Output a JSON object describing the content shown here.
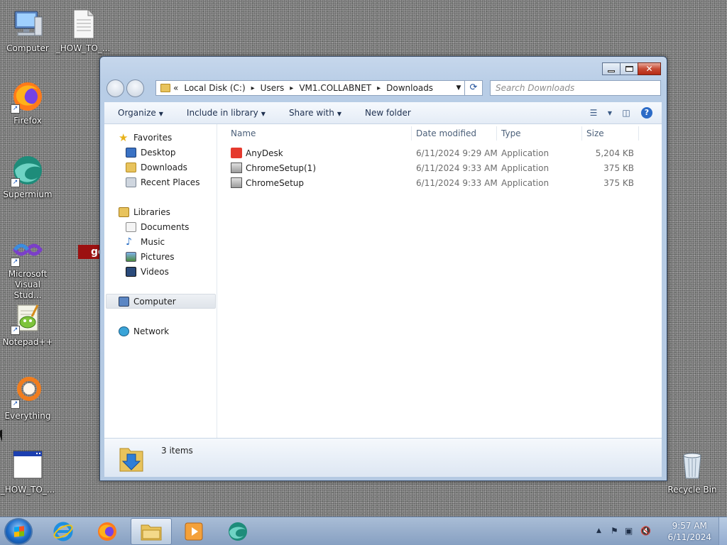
{
  "desktop": {
    "icons": [
      {
        "label": "Computer"
      },
      {
        "label": "_HOW_TO_..."
      },
      {
        "label": "Firefox"
      },
      {
        "label": "Supermium"
      },
      {
        "label": "Microsoft Visual Stud..."
      },
      {
        "label": "Notepad++"
      },
      {
        "label": "Everything"
      },
      {
        "label": "_HOW_TO_..."
      },
      {
        "label": "Recycle Bin"
      }
    ],
    "partial_text": "ge"
  },
  "window": {
    "address": {
      "overflow": "«",
      "crumbs": [
        "Local Disk (C:)",
        "Users",
        "VM1.COLLABNET",
        "Downloads"
      ]
    },
    "search_placeholder": "Search Downloads",
    "toolbar": {
      "organize": "Organize",
      "include_in_library": "Include in library",
      "share_with": "Share with",
      "new_folder": "New folder"
    },
    "nav": {
      "favorites": "Favorites",
      "desktop": "Desktop",
      "downloads": "Downloads",
      "recent_places": "Recent Places",
      "libraries": "Libraries",
      "documents": "Documents",
      "music": "Music",
      "pictures": "Pictures",
      "videos": "Videos",
      "computer": "Computer",
      "network": "Network"
    },
    "columns": {
      "name": "Name",
      "date_modified": "Date modified",
      "type": "Type",
      "size": "Size"
    },
    "files": [
      {
        "name": "AnyDesk",
        "date": "6/11/2024 9:29 AM",
        "type": "Application",
        "size": "5,204 KB"
      },
      {
        "name": "ChromeSetup(1)",
        "date": "6/11/2024 9:33 AM",
        "type": "Application",
        "size": "375 KB"
      },
      {
        "name": "ChromeSetup",
        "date": "6/11/2024 9:33 AM",
        "type": "Application",
        "size": "375 KB"
      }
    ],
    "details": {
      "count": "3 items"
    }
  },
  "taskbar": {
    "time": "9:57 AM",
    "date": "6/11/2024"
  }
}
